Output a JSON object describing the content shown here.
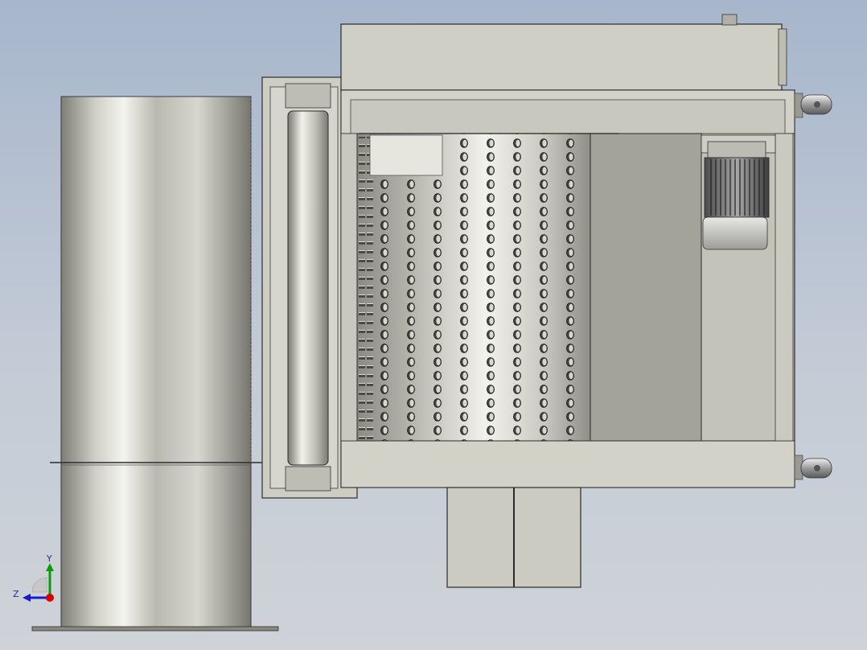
{
  "view": {
    "title": "",
    "colors": {
      "bg_top": "#a7b6cc",
      "bg_bottom": "#cfd3d8",
      "housing": "#cfcfc6",
      "housing_dark": "#a9a99e",
      "edge": "#2c2c2c",
      "motor_body": "#6f6f6f",
      "x_axis": "#d40000",
      "y_axis": "#0a9a0a",
      "z_axis": "#1a1acc"
    }
  },
  "triad": {
    "y_label": "Y",
    "z_label": "Z",
    "icon": "coordinate-triad-icon"
  },
  "components": {
    "tank": "cylindrical-tank-icon",
    "drum": "perforated-drum-icon",
    "motor": "gear-motor-icon",
    "roller": "roller-icon",
    "caster_top": "caster-wheel-icon",
    "caster_bottom": "caster-wheel-icon",
    "outlet": "discharge-chute-icon"
  }
}
